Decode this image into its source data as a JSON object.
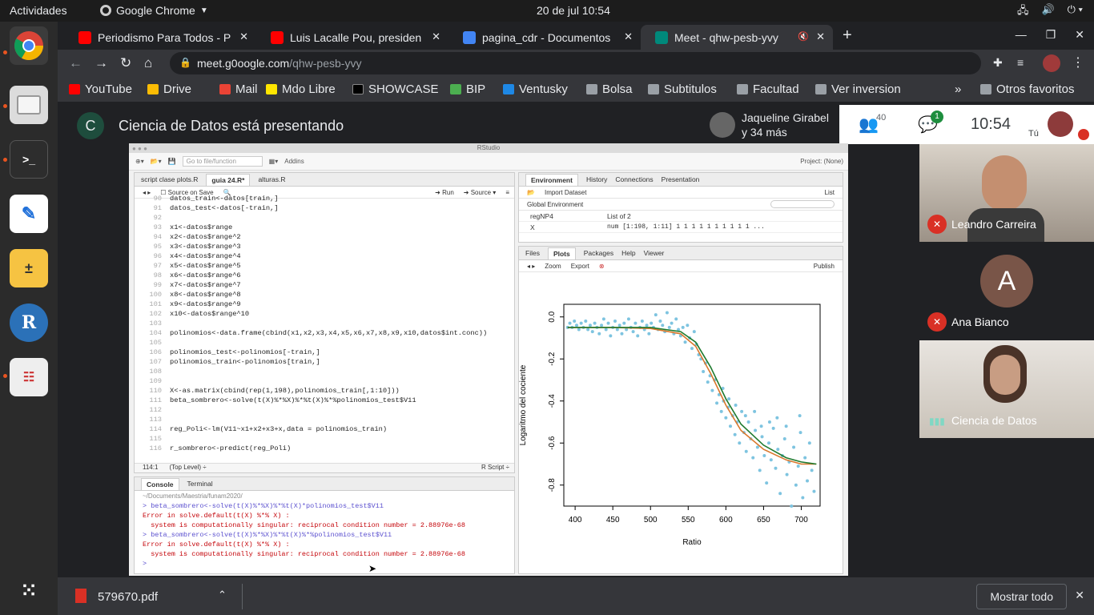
{
  "topbar": {
    "activities": "Actividades",
    "app": "Google Chrome",
    "datetime": "20 de jul  10:54"
  },
  "tabs": [
    {
      "title": "Periodismo Para Todos - P",
      "color": "#ff0000"
    },
    {
      "title": "Luis Lacalle Pou, presiden",
      "color": "#ff0000"
    },
    {
      "title": "pagina_cdr - Documentos",
      "color": "#4285f4"
    },
    {
      "title": "Meet - qhw-pesb-yvy",
      "color": "#00897b"
    }
  ],
  "address": {
    "host": "meet.g0oogle.com",
    "path": "/qhw-pesb-yvy"
  },
  "bookmarks": [
    "YouTube",
    "Drive",
    "Mail",
    "Mdo Libre",
    "SHOWCASE",
    "BIP",
    "Ventusky",
    "Bolsa",
    "Subtitulos",
    "Facultad",
    "Ver inversion",
    "»",
    "Otros favoritos"
  ],
  "meet": {
    "presenter_initial": "C",
    "presenting_text": "Ciencia de Datos está presentando",
    "joined_name": "Jaqueline Girabel",
    "joined_more": "y 34 más",
    "people_count": "40",
    "chat_badge": "1",
    "time": "10:54",
    "you_label": "Tú",
    "participants": [
      {
        "name": "Leandro Carreira"
      },
      {
        "name": "Ana Bianco",
        "initial": "A"
      },
      {
        "name": "Ciencia de Datos"
      }
    ]
  },
  "rstudio": {
    "window_title": "RStudio",
    "goto_placeholder": "Go to file/function",
    "addins": "Addins",
    "project": "Project: (None)",
    "editor_tabs": [
      "script clase plots.R",
      "guia 24.R*",
      "alturas.R"
    ],
    "source_on_save": "Source on Save",
    "run": "Run",
    "source": "Source",
    "code_lines": [
      {
        "n": "90",
        "t": "datos_train<-datos[train,]"
      },
      {
        "n": "91",
        "t": "datos_test<-datos[-train,]"
      },
      {
        "n": "92",
        "t": ""
      },
      {
        "n": "93",
        "t": "x1<-datos$range"
      },
      {
        "n": "94",
        "t": "x2<-datos$range^2"
      },
      {
        "n": "95",
        "t": "x3<-datos$range^3"
      },
      {
        "n": "96",
        "t": "x4<-datos$range^4"
      },
      {
        "n": "97",
        "t": "x5<-datos$range^5"
      },
      {
        "n": "98",
        "t": "x6<-datos$range^6"
      },
      {
        "n": "99",
        "t": "x7<-datos$range^7"
      },
      {
        "n": "100",
        "t": "x8<-datos$range^8"
      },
      {
        "n": "101",
        "t": "x9<-datos$range^9"
      },
      {
        "n": "102",
        "t": "x10<-datos$range^10"
      },
      {
        "n": "103",
        "t": ""
      },
      {
        "n": "104",
        "t": "polinomios<-data.frame(cbind(x1,x2,x3,x4,x5,x6,x7,x8,x9,x10,datos$int.conc))"
      },
      {
        "n": "105",
        "t": ""
      },
      {
        "n": "106",
        "t": "polinomios_test<-polinomios[-train,]"
      },
      {
        "n": "107",
        "t": "polinomios_train<-polinomios[train,]"
      },
      {
        "n": "108",
        "t": ""
      },
      {
        "n": "109",
        "t": ""
      },
      {
        "n": "110",
        "t": "X<-as.matrix(cbind(rep(1,198),polinomios_train[,1:10]))"
      },
      {
        "n": "111",
        "t": "beta_sombrero<-solve(t(X)%*%X)%*%t(X)%*%polinomios_test$V11"
      },
      {
        "n": "112",
        "t": ""
      },
      {
        "n": "113",
        "t": ""
      },
      {
        "n": "114",
        "t": "reg_Poli<-lm(V11~x1+x2+x3+x,data = polinomios_train)"
      },
      {
        "n": "115",
        "t": ""
      },
      {
        "n": "116",
        "t": "r_sombrero<-predict(reg_Poli)"
      },
      {
        "n": "117",
        "t": ""
      }
    ],
    "status_pos": "114:1",
    "status_level": "(Top Level) ÷",
    "status_type": "R Script ÷",
    "console_tabs": [
      "Console",
      "Terminal"
    ],
    "console_path": "~/Documents/Maestria/funam2020/",
    "console_lines": [
      {
        "t": "> beta_sombrero<-solve(t(X)%*%X)%*%t(X)*polinomios_test$V11",
        "k": "cmd"
      },
      {
        "t": "Error in solve.default(t(X) %*% X) :",
        "k": "err"
      },
      {
        "t": "  system is computationally singular: reciprocal condition number = 2.88976e-68",
        "k": "err"
      },
      {
        "t": "> beta_sombrero<-solve(t(X)%*%X)%*%t(X)%*%polinomios_test$V11",
        "k": "cmd"
      },
      {
        "t": "Error in solve.default(t(X) %*% X) :",
        "k": "err"
      },
      {
        "t": "  system is computationally singular: reciprocal condition number = 2.88976e-68",
        "k": "err"
      },
      {
        "t": ">",
        "k": "cmd"
      }
    ],
    "env_tabs": [
      "Environment",
      "History",
      "Connections",
      "Presentation"
    ],
    "import_dataset": "Import Dataset",
    "global_env": "Global Environment",
    "list_label": "List",
    "env_rows": [
      {
        "name": "regNP4",
        "value": "List of 2"
      },
      {
        "name": "X",
        "value": "num [1:198, 1:11] 1 1 1 1 1 1 1 1 1 1 ..."
      }
    ],
    "files_tabs": [
      "Files",
      "Plots",
      "Packages",
      "Help",
      "Viewer"
    ],
    "zoom": "Zoom",
    "export": "Export",
    "publish": "Publish"
  },
  "chart_data": {
    "type": "scatter",
    "xlabel": "Ratio",
    "ylabel": "Logaritmo del cociente",
    "xlim": [
      385,
      725
    ],
    "ylim": [
      -0.9,
      0.06
    ],
    "xticks": [
      400,
      450,
      500,
      550,
      600,
      650,
      700
    ],
    "yticks": [
      0.0,
      -0.2,
      -0.4,
      -0.6,
      -0.8
    ],
    "point_color": "#7ec4e0",
    "curves": [
      {
        "color": "#d9772b",
        "x": [
          390,
          450,
          500,
          540,
          560,
          580,
          600,
          620,
          650,
          680,
          700,
          720
        ],
        "y": [
          -0.05,
          -0.05,
          -0.055,
          -0.08,
          -0.14,
          -0.27,
          -0.42,
          -0.54,
          -0.63,
          -0.68,
          -0.7,
          -0.7
        ]
      },
      {
        "color": "#1f7a2e",
        "x": [
          390,
          450,
          500,
          540,
          560,
          580,
          600,
          620,
          650,
          680,
          700,
          720
        ],
        "y": [
          -0.05,
          -0.05,
          -0.05,
          -0.07,
          -0.12,
          -0.24,
          -0.39,
          -0.51,
          -0.61,
          -0.67,
          -0.69,
          -0.7
        ]
      }
    ],
    "points": [
      [
        390,
        -0.05
      ],
      [
        393,
        -0.03
      ],
      [
        396,
        -0.05
      ],
      [
        399,
        -0.02
      ],
      [
        402,
        -0.04
      ],
      [
        405,
        -0.06
      ],
      [
        408,
        -0.03
      ],
      [
        411,
        -0.05
      ],
      [
        414,
        -0.02
      ],
      [
        417,
        -0.06
      ],
      [
        420,
        -0.04
      ],
      [
        423,
        -0.07
      ],
      [
        426,
        -0.03
      ],
      [
        429,
        -0.05
      ],
      [
        432,
        -0.08
      ],
      [
        435,
        -0.04
      ],
      [
        438,
        -0.01
      ],
      [
        441,
        -0.06
      ],
      [
        444,
        -0.03
      ],
      [
        447,
        -0.09
      ],
      [
        450,
        -0.05
      ],
      [
        453,
        -0.02
      ],
      [
        456,
        -0.06
      ],
      [
        459,
        -0.04
      ],
      [
        462,
        -0.08
      ],
      [
        465,
        -0.03
      ],
      [
        468,
        -0.06
      ],
      [
        471,
        -0.01
      ],
      [
        474,
        -0.05
      ],
      [
        477,
        -0.07
      ],
      [
        480,
        -0.03
      ],
      [
        483,
        -0.09
      ],
      [
        486,
        -0.05
      ],
      [
        489,
        -0.02
      ],
      [
        492,
        -0.06
      ],
      [
        495,
        -0.04
      ],
      [
        498,
        -0.08
      ],
      [
        501,
        -0.03
      ],
      [
        504,
        -0.05
      ],
      [
        507,
        0.01
      ],
      [
        510,
        -0.06
      ],
      [
        513,
        -0.02
      ],
      [
        516,
        -0.04
      ],
      [
        519,
        -0.07
      ],
      [
        522,
        0.02
      ],
      [
        525,
        -0.05
      ],
      [
        528,
        -0.03
      ],
      [
        531,
        -0.08
      ],
      [
        534,
        -0.01
      ],
      [
        537,
        -0.06
      ],
      [
        540,
        -0.09
      ],
      [
        543,
        -0.05
      ],
      [
        546,
        -0.12
      ],
      [
        549,
        -0.04
      ],
      [
        552,
        -0.1
      ],
      [
        555,
        -0.15
      ],
      [
        558,
        -0.07
      ],
      [
        561,
        -0.13
      ],
      [
        564,
        -0.18
      ],
      [
        567,
        -0.2
      ],
      [
        570,
        -0.26
      ],
      [
        573,
        -0.22
      ],
      [
        576,
        -0.31
      ],
      [
        579,
        -0.28
      ],
      [
        582,
        -0.35
      ],
      [
        585,
        -0.3
      ],
      [
        588,
        -0.41
      ],
      [
        591,
        -0.37
      ],
      [
        594,
        -0.45
      ],
      [
        597,
        -0.4
      ],
      [
        600,
        -0.48
      ],
      [
        603,
        -0.43
      ],
      [
        606,
        -0.52
      ],
      [
        609,
        -0.47
      ],
      [
        612,
        -0.56
      ],
      [
        615,
        -0.5
      ],
      [
        618,
        -0.6
      ],
      [
        621,
        -0.45
      ],
      [
        624,
        -0.55
      ],
      [
        627,
        -0.64
      ],
      [
        630,
        -0.5
      ],
      [
        633,
        -0.58
      ],
      [
        636,
        -0.67
      ],
      [
        639,
        -0.54
      ],
      [
        642,
        -0.62
      ],
      [
        645,
        -0.73
      ],
      [
        648,
        -0.57
      ],
      [
        651,
        -0.66
      ],
      [
        654,
        -0.79
      ],
      [
        657,
        -0.6
      ],
      [
        660,
        -0.68
      ],
      [
        663,
        -0.53
      ],
      [
        666,
        -0.72
      ],
      [
        669,
        -0.63
      ],
      [
        672,
        -0.84
      ],
      [
        675,
        -0.66
      ],
      [
        678,
        -0.58
      ],
      [
        681,
        -0.75
      ],
      [
        684,
        -0.69
      ],
      [
        687,
        -0.9
      ],
      [
        690,
        -0.62
      ],
      [
        693,
        -0.8
      ],
      [
        696,
        -0.71
      ],
      [
        699,
        -0.55
      ],
      [
        702,
        -0.86
      ],
      [
        705,
        -0.67
      ],
      [
        708,
        -0.78
      ],
      [
        711,
        -0.6
      ],
      [
        714,
        -0.73
      ],
      [
        717,
        -0.83
      ],
      [
        596,
        -0.34
      ],
      [
        604,
        -0.39
      ],
      [
        613,
        -0.42
      ],
      [
        626,
        -0.47
      ],
      [
        638,
        -0.45
      ],
      [
        647,
        -0.52
      ],
      [
        658,
        -0.5
      ],
      [
        668,
        -0.48
      ],
      [
        680,
        -0.52
      ],
      [
        698,
        -0.47
      ]
    ]
  },
  "download": {
    "file": "579670.pdf",
    "show_all": "Mostrar todo"
  }
}
